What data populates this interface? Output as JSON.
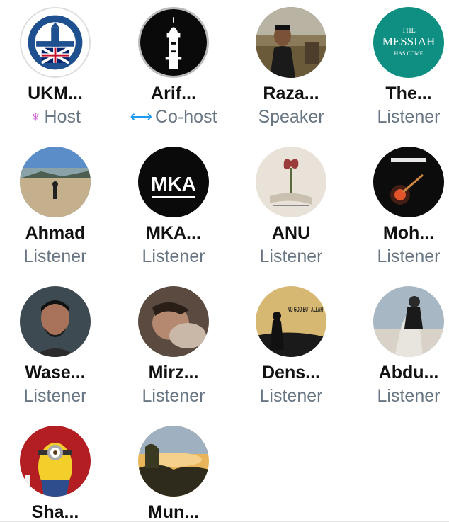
{
  "participants": [
    {
      "name": "UKM...",
      "role": "Host",
      "role_icon": "host-icon",
      "role_icon_color": "#c94fd1"
    },
    {
      "name": "Arif...",
      "role": "Co-host",
      "role_icon": "co-host-icon",
      "role_icon_color": "#1d9bf0"
    },
    {
      "name": "Raza...",
      "role": "Speaker"
    },
    {
      "name": "The...",
      "role": "Listener"
    },
    {
      "name": "Ahmad",
      "role": "Listener"
    },
    {
      "name": "MKA...",
      "role": "Listener"
    },
    {
      "name": "ANU",
      "role": "Listener"
    },
    {
      "name": "Moh...",
      "role": "Listener"
    },
    {
      "name": "Wase...",
      "role": "Listener"
    },
    {
      "name": "Mirz...",
      "role": "Listener"
    },
    {
      "name": "Dens...",
      "role": "Listener"
    },
    {
      "name": "Abdu...",
      "role": "Listener"
    },
    {
      "name": "Sha...",
      "role": ""
    },
    {
      "name": "Mun...",
      "role": ""
    }
  ],
  "avatar_text": {
    "messiah_line1": "THE",
    "messiah_line2": "MESSIAH",
    "messiah_line3": "HAS COME",
    "mka_logo": "MKA",
    "dens_text": "NO GOD BUT ALLAH"
  },
  "colors": {
    "name": "#111111",
    "role": "#687684"
  }
}
